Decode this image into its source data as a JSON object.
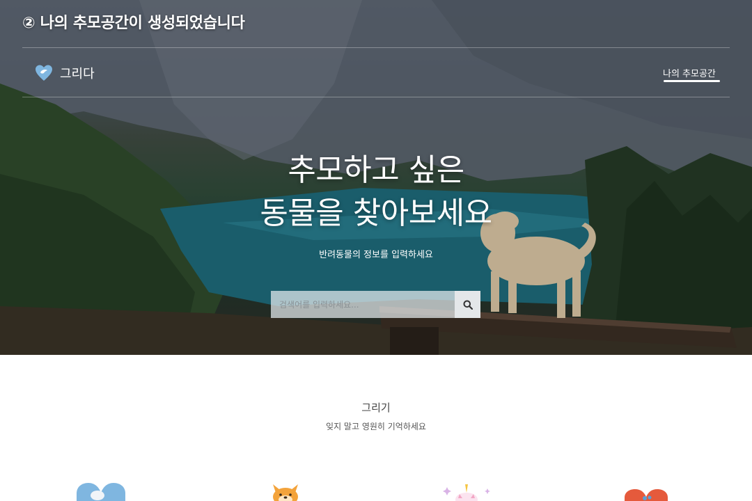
{
  "caption": "② 나의 추모공간이 생성되었습니다",
  "header": {
    "brand": "그리다",
    "nav_link": "나의 추모공간"
  },
  "hero": {
    "headline_line1": "추모하고 싶은",
    "headline_line2": "동물을 찾아보세요",
    "subline": "반려동물의 정보를 입력하세요",
    "search": {
      "placeholder": "검색어를 입력하세요...",
      "value": ""
    }
  },
  "section": {
    "title": "그리기",
    "subtitle": "잊지 말고 영원히 기억하세요"
  },
  "icons": [
    "blue-heart-icon",
    "shiba-dog-icon",
    "unicorn-icon",
    "red-heart-icon"
  ],
  "colors": {
    "accent": "#ffffff",
    "search_button": "#e4e7e9",
    "heart_blue": "#7fb6e0",
    "heart_red": "#e55a3c"
  }
}
